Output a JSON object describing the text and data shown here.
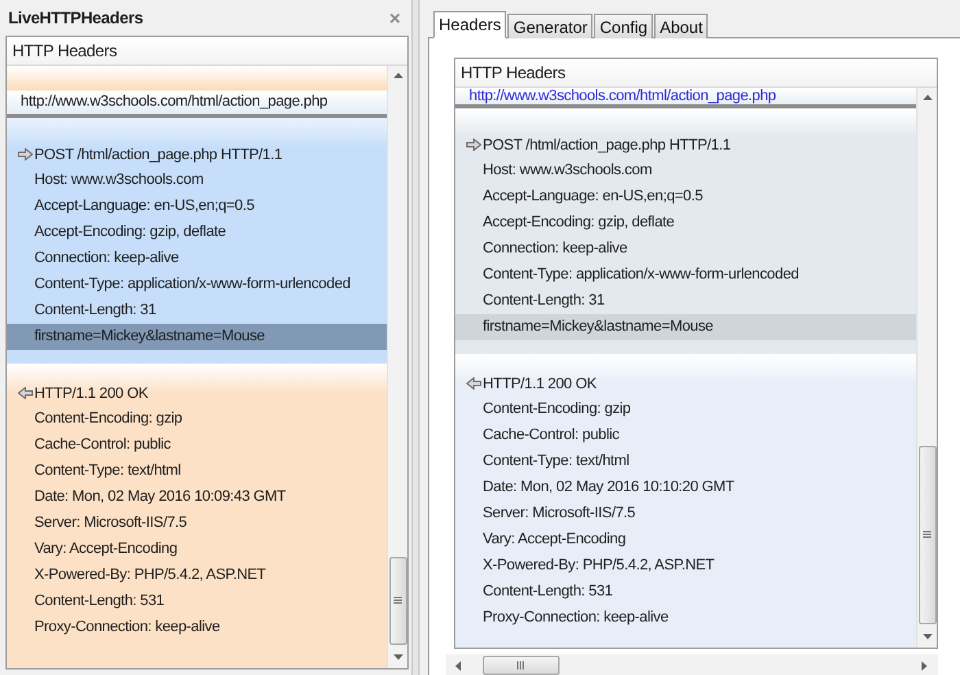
{
  "sidebar": {
    "title": "LiveHTTPHeaders",
    "close": "×",
    "viewer": {
      "header": "HTTP Headers",
      "url": "http://www.w3schools.com/html/action_page.php",
      "request": {
        "status_line": "POST /html/action_page.php HTTP/1.1",
        "headers": [
          "Host: www.w3schools.com",
          "Accept-Language: en-US,en;q=0.5",
          "Accept-Encoding: gzip, deflate",
          "Connection: keep-alive",
          "Content-Type: application/x-www-form-urlencoded",
          "Content-Length: 31"
        ],
        "body": {
          "text": "firstname=Mickey&lastname=Mouse",
          "selected": true
        }
      },
      "response": {
        "status_line": "HTTP/1.1 200 OK",
        "headers": [
          "Content-Encoding: gzip",
          "Cache-Control: public",
          "Content-Type: text/html",
          "Date: Mon, 02 May 2016 10:09:43 GMT",
          "Server: Microsoft-IIS/7.5",
          "Vary: Accept-Encoding",
          "X-Powered-By: PHP/5.4.2, ASP.NET",
          "Content-Length: 531",
          "Proxy-Connection: keep-alive"
        ]
      }
    }
  },
  "tabs": [
    {
      "label": "Headers",
      "selected": true
    },
    {
      "label": "Generator",
      "selected": false
    },
    {
      "label": "Config",
      "selected": false
    },
    {
      "label": "About",
      "selected": false
    }
  ],
  "main": {
    "viewer": {
      "header": "HTTP Headers",
      "url": "http://www.w3schools.com/html/action_page.php",
      "request": {
        "status_line": "POST /html/action_page.php HTTP/1.1",
        "headers": [
          "Host: www.w3schools.com",
          "Accept-Language: en-US,en;q=0.5",
          "Accept-Encoding: gzip, deflate",
          "Connection: keep-alive",
          "Content-Type: application/x-www-form-urlencoded",
          "Content-Length: 31"
        ],
        "body": {
          "text": "firstname=Mickey&lastname=Mouse",
          "selected": true
        }
      },
      "response": {
        "status_line": "HTTP/1.1 200 OK",
        "headers": [
          "Content-Encoding: gzip",
          "Cache-Control: public",
          "Content-Type: text/html",
          "Date: Mon, 02 May 2016 10:10:20 GMT",
          "Server: Microsoft-IIS/7.5",
          "Vary: Accept-Encoding",
          "X-Powered-By: PHP/5.4.2, ASP.NET",
          "Content-Length: 531",
          "Proxy-Connection: keep-alive"
        ]
      }
    }
  }
}
